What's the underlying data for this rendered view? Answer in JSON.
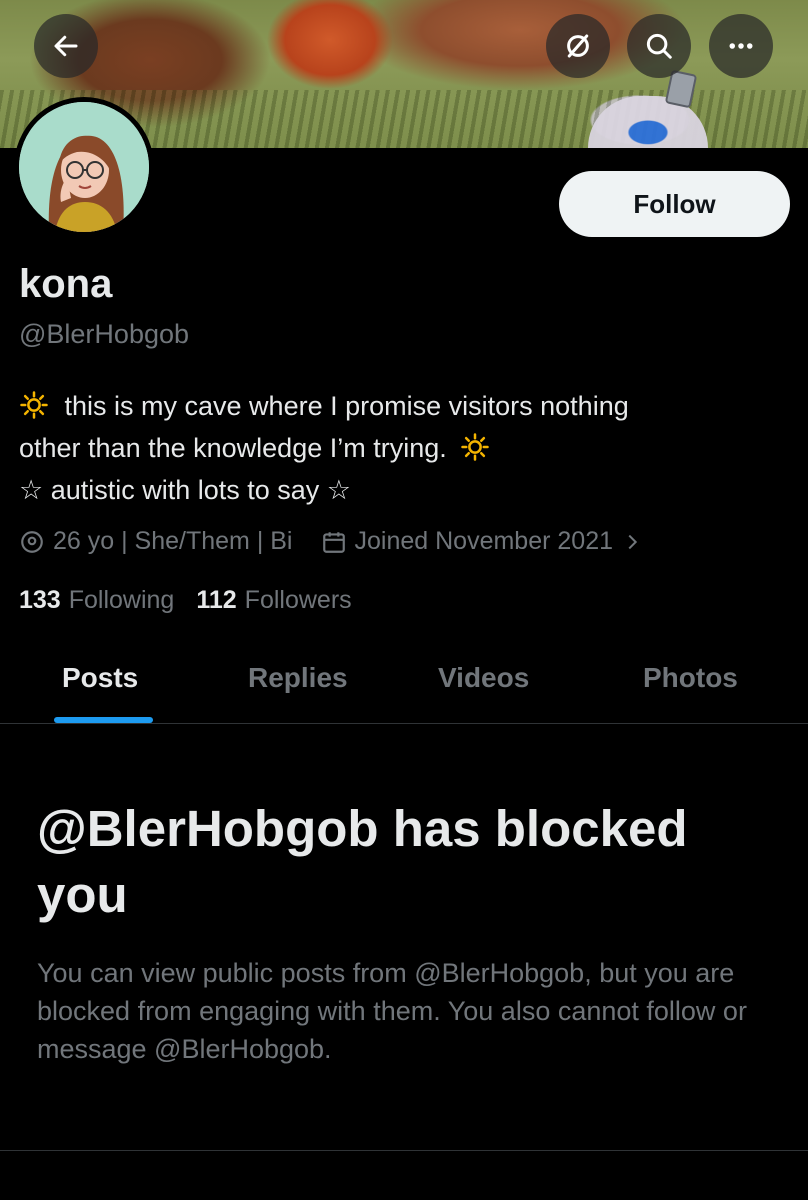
{
  "header": {
    "back_icon": "arrow-left-icon",
    "grok_icon": "slash-circle-icon",
    "search_icon": "search-icon",
    "more_icon": "more-horizontal-icon"
  },
  "profile": {
    "name": "kona",
    "handle": "@BlerHobgob",
    "follow_label": "Follow",
    "bio_line1": "this is my cave where I promise visitors nothing",
    "bio_line2": "other than the knowledge I’m trying.",
    "bio_line3": "☆ autistic with lots to say ☆",
    "location": "26 yo | She/Them | Bi",
    "joined": "Joined November 2021",
    "following_count": "133",
    "following_label": "Following",
    "followers_count": "112",
    "followers_label": "Followers"
  },
  "tabs": [
    {
      "label": "Posts"
    },
    {
      "label": "Replies"
    },
    {
      "label": "Videos"
    },
    {
      "label": "Photos"
    }
  ],
  "blocked": {
    "title": "@BlerHobgob has blocked you",
    "description": "You can view public posts from @BlerHobgob, but you are blocked from engaging with them. You also cannot follow or message @BlerHobgob."
  },
  "colors": {
    "accent": "#1d9bf0",
    "muted": "#71767b",
    "text": "#e7e9ea",
    "sun": "#f4b400"
  }
}
